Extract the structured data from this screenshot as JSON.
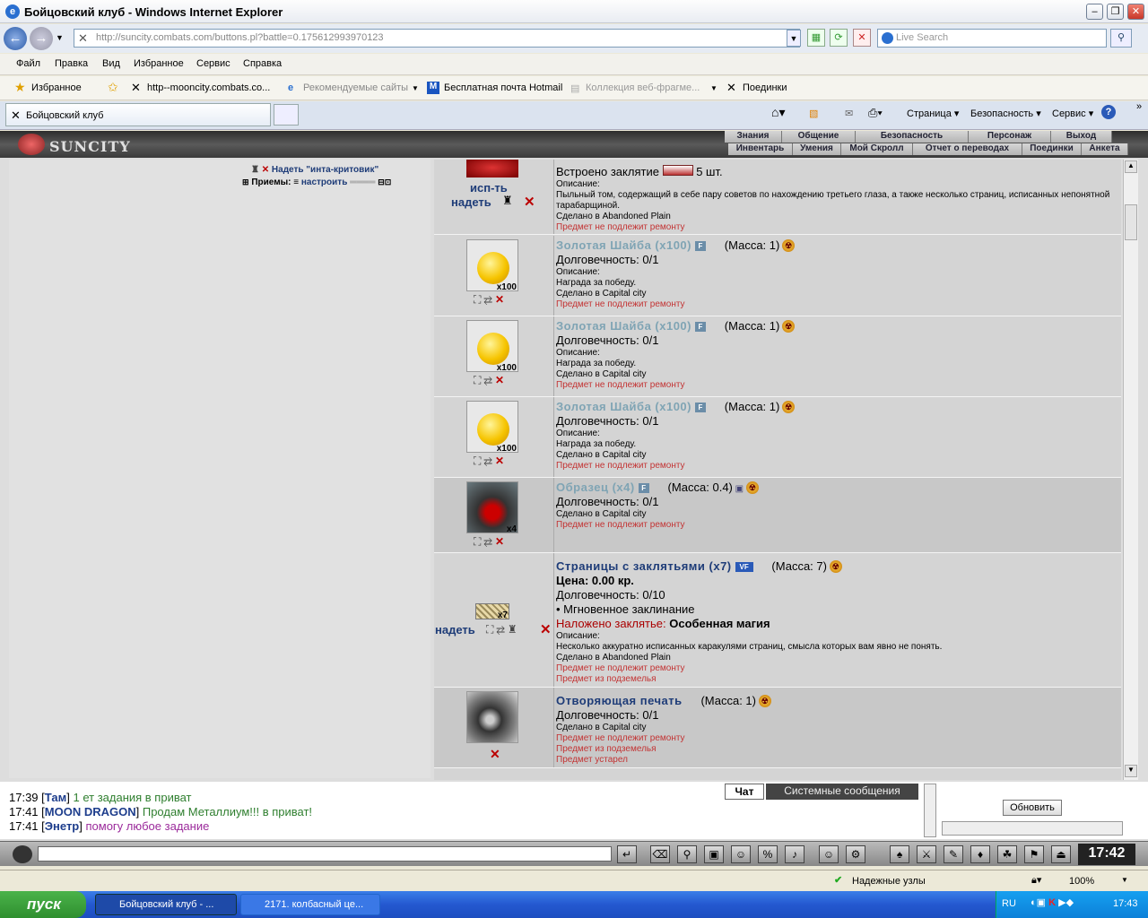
{
  "window": {
    "title": "Бойцовский клуб - Windows Internet Explorer"
  },
  "address": {
    "url": "http://suncity.combats.com/buttons.pl?battle=0.175612993970123",
    "search_placeholder": "Live Search"
  },
  "menu": [
    "Файл",
    "Правка",
    "Вид",
    "Избранное",
    "Сервис",
    "Справка"
  ],
  "favorites": {
    "label": "Избранное",
    "links": [
      "http--mooncity.combats.co...",
      "Рекомендуемые сайты",
      "Бесплатная почта Hotmail",
      "Коллекция веб-фрагме...",
      "Поединки"
    ]
  },
  "tabs": {
    "active": "Бойцовский клуб",
    "commands": [
      "Страница",
      "Безопасность",
      "Сервис"
    ]
  },
  "game": {
    "logo": "SUNCITY",
    "nav_top": [
      "Знания",
      "Общение",
      "Безопасность",
      "Персонаж",
      "Выход"
    ],
    "nav_bottom": [
      "Инвентарь",
      "Умения",
      "Мой Скролл",
      "Отчет о переводах",
      "Поединки",
      "Анкета"
    ],
    "left": {
      "equip_link": "Надеть \"инта-критовик\"",
      "techniques_label": "Приемы:",
      "techniques_link": "настроить"
    }
  },
  "items": [
    {
      "name": "",
      "actions": [
        "исп-ть",
        "надеть"
      ],
      "lines": [
        "Встроено заклятие",
        "5 шт.",
        "Описание:",
        "Пыльный том, содержащий в себе пару советов по нахождению третьего глаза, а также несколько страниц, исписанных непонятной тарабарщиной.",
        "Сделано в Abandoned Plain",
        "Предмет не подлежит ремонту"
      ]
    },
    {
      "name": "Золотая Шайба (x100)",
      "mass": "(Масса: 1)",
      "count": "x100",
      "durability": "Долговечность: 0/1",
      "desc_label": "Описание:",
      "desc": "Награда за победу.",
      "made": "Сделано в Capital city",
      "repair": "Предмет не подлежит ремонту"
    },
    {
      "name": "Золотая Шайба (x100)",
      "mass": "(Масса: 1)",
      "count": "x100",
      "durability": "Долговечность: 0/1",
      "desc_label": "Описание:",
      "desc": "Награда за победу.",
      "made": "Сделано в Capital city",
      "repair": "Предмет не подлежит ремонту"
    },
    {
      "name": "Золотая Шайба (x100)",
      "mass": "(Масса: 1)",
      "count": "x100",
      "durability": "Долговечность: 0/1",
      "desc_label": "Описание:",
      "desc": "Награда за победу.",
      "made": "Сделано в Capital city",
      "repair": "Предмет не подлежит ремонту"
    },
    {
      "name": "Образец (x4)",
      "mass": "(Масса: 0.4)",
      "count": "x4",
      "durability": "Долговечность: 0/1",
      "made": "Сделано в Capital city",
      "repair": "Предмет не подлежит ремонту"
    },
    {
      "name": "Страницы с заклятьями (x7)",
      "mass": "(Масса: 7)",
      "count": "x7",
      "action": "надеть",
      "price": "Цена: 0.00 кр.",
      "durability": "Долговечность: 0/10",
      "instant": "• Мгновенное заклинание",
      "spell_label": "Наложено заклятье:",
      "spell": "Особенная магия",
      "desc_label": "Описание:",
      "desc": "Несколько аккуратно исписанных каракулями страниц, смысла которых вам явно не понять.",
      "made": "Сделано в Abandoned Plain",
      "repair": "Предмет не подлежит ремонту",
      "dungeon": "Предмет из подземелья"
    },
    {
      "name": "Отворяющая печать",
      "mass": "(Масса: 1)",
      "durability": "Долговечность: 0/1",
      "made": "Сделано в Capital city",
      "repair": "Предмет не подлежит ремонту",
      "dungeon": "Предмет из подземелья",
      "expired": "Предмет устарел"
    }
  ],
  "chat": {
    "lines": [
      {
        "time": "17:39",
        "nick": "Там",
        "text": "1 ет задания в приват",
        "color": "#2f7f2f"
      },
      {
        "time": "17:41",
        "nick": "MOON DRAGON",
        "text": "Продам Металлиум!!! в приват!",
        "color": "#2f7f2f"
      },
      {
        "time": "17:41",
        "nick": "Энетр",
        "text": "помогу любое задание",
        "color": "#9b2a9b"
      }
    ],
    "tabs": [
      "Чат",
      "Системные сообщения"
    ],
    "refresh": "Обновить",
    "clock": "17:42"
  },
  "status": {
    "zone": "Надежные узлы",
    "zoom": "100%"
  },
  "taskbar": {
    "start": "пуск",
    "tasks": [
      "Бойцовский клуб - ...",
      "2171. колбасный це..."
    ],
    "lang": "RU",
    "time": "17:43"
  }
}
